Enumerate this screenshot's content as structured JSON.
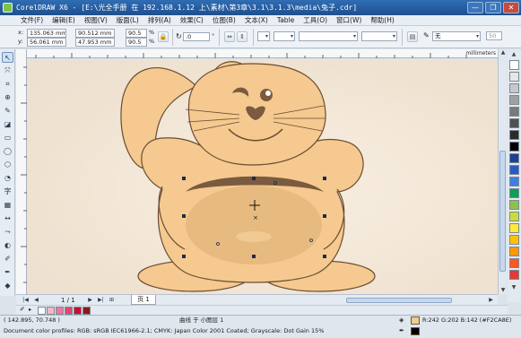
{
  "window": {
    "title": "CorelDRAW X6 - [E:\\光全手册 在 192.168.1.12 上\\素材\\第3章\\3.1\\3.1.3\\media\\兔子.cdr]",
    "controls": [
      "—",
      "❐",
      "✕"
    ]
  },
  "menu": [
    "文件(F)",
    "编辑(E)",
    "视图(V)",
    "版面(L)",
    "排列(A)",
    "效果(C)",
    "位图(B)",
    "文本(X)",
    "Table",
    "工具(O)",
    "窗口(W)",
    "帮助(H)"
  ],
  "property_bar": {
    "x_label": "x:",
    "x_value": "135.063 mm",
    "y_label": "y:",
    "y_value": "56.061 mm",
    "w_value": "90.512 mm",
    "h_value": "47.953 mm",
    "scale_x": "90.5",
    "scale_y": "90.5",
    "scale_unit": "%",
    "angle": ".0",
    "angle_unit": "°",
    "outline_width": "无",
    "extra_value": "50",
    "icons": [
      "lock-icon",
      "mirror-h-icon",
      "mirror-v-icon",
      "wrap-icon",
      "outline-icon"
    ]
  },
  "ruler": {
    "unit": "millimeters",
    "top_labels": [
      "100",
      "150",
      "200",
      "250",
      "300"
    ]
  },
  "toolbox": {
    "tools": [
      "pick-tool-icon",
      "shape-tool-icon",
      "crop-tool-icon",
      "zoom-tool-icon",
      "freehand-tool-icon",
      "smart-fill-icon",
      "rectangle-tool-icon",
      "ellipse-tool-icon",
      "polygon-tool-icon",
      "text-tool-icon",
      "table-tool-icon",
      "dimension-tool-icon",
      "connector-tool-icon",
      "blend-tool-icon",
      "eyedropper-tool-icon",
      "outline-tool-icon",
      "fill-tool-icon",
      "interactive-fill-icon"
    ]
  },
  "palette": {
    "colors": [
      "#ffffff",
      "#e6e6e6",
      "#c8c8c8",
      "#a0a0a0",
      "#7a7a7a",
      "#505050",
      "#2a2a2a",
      "#000000",
      "#1f3f8f",
      "#2b59c3",
      "#3f7fe0",
      "#0f9d58",
      "#8bc34a",
      "#cddc39",
      "#ffeb3b",
      "#ffc107",
      "#ff9800",
      "#ff5722",
      "#e53935"
    ]
  },
  "pagebar": {
    "page_count": "1 / 1",
    "page_tab": "页 1"
  },
  "colorstrip": {
    "colors": [
      "#ffffff",
      "#f2b8c6",
      "#e97aa1",
      "#e2466f",
      "#c8102e",
      "#8b1a1a"
    ]
  },
  "status": {
    "coordinates": "( 142.895, 70.748 )",
    "message": "曲线 于 小图层 1",
    "profiles": "Document color profiles: RGB: sRGB IEC61966-2.1; CMYK: Japan Color 2001 Coated; Grayscale: Dot Gain 15%",
    "fill_info": "R:242 G:202 B:142 (#F2CA8E)",
    "fill_color": "#F2CA8E",
    "outline_color": "#000000"
  }
}
